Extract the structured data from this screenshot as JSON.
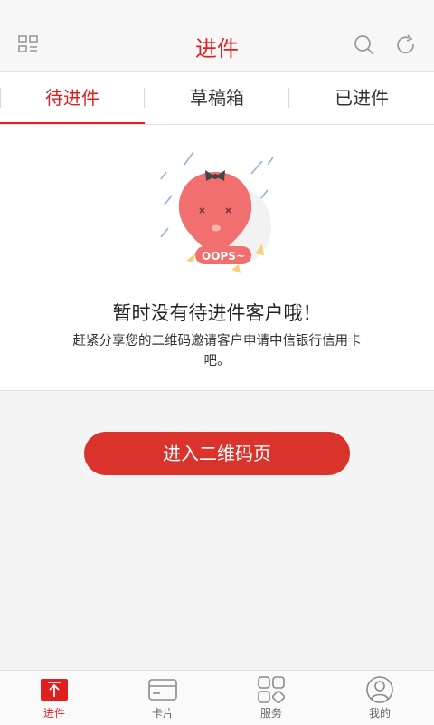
{
  "header": {
    "title": "进件",
    "left_icon": "qr-grid-icon",
    "right_icons": [
      "search-icon",
      "refresh-icon"
    ]
  },
  "tabs": [
    {
      "label": "待进件",
      "active": true
    },
    {
      "label": "草稿箱",
      "active": false
    },
    {
      "label": "已进件",
      "active": false
    }
  ],
  "empty_state": {
    "illustration_text": "OOPS~",
    "title": "暂时没有待进件客户哦！",
    "description": "赶紧分享您的二维码邀请客户申请中信银行信用卡吧。"
  },
  "actions": {
    "qr_button_label": "进入二维码页"
  },
  "bottom_nav": [
    {
      "label": "进件",
      "icon": "upload-icon",
      "active": true
    },
    {
      "label": "卡片",
      "icon": "card-icon",
      "active": false
    },
    {
      "label": "服务",
      "icon": "services-grid-icon",
      "active": false
    },
    {
      "label": "我的",
      "icon": "profile-icon",
      "active": false
    }
  ],
  "colors": {
    "accent": "#e02020",
    "button": "#d9332b",
    "background": "#f4f4f4"
  }
}
